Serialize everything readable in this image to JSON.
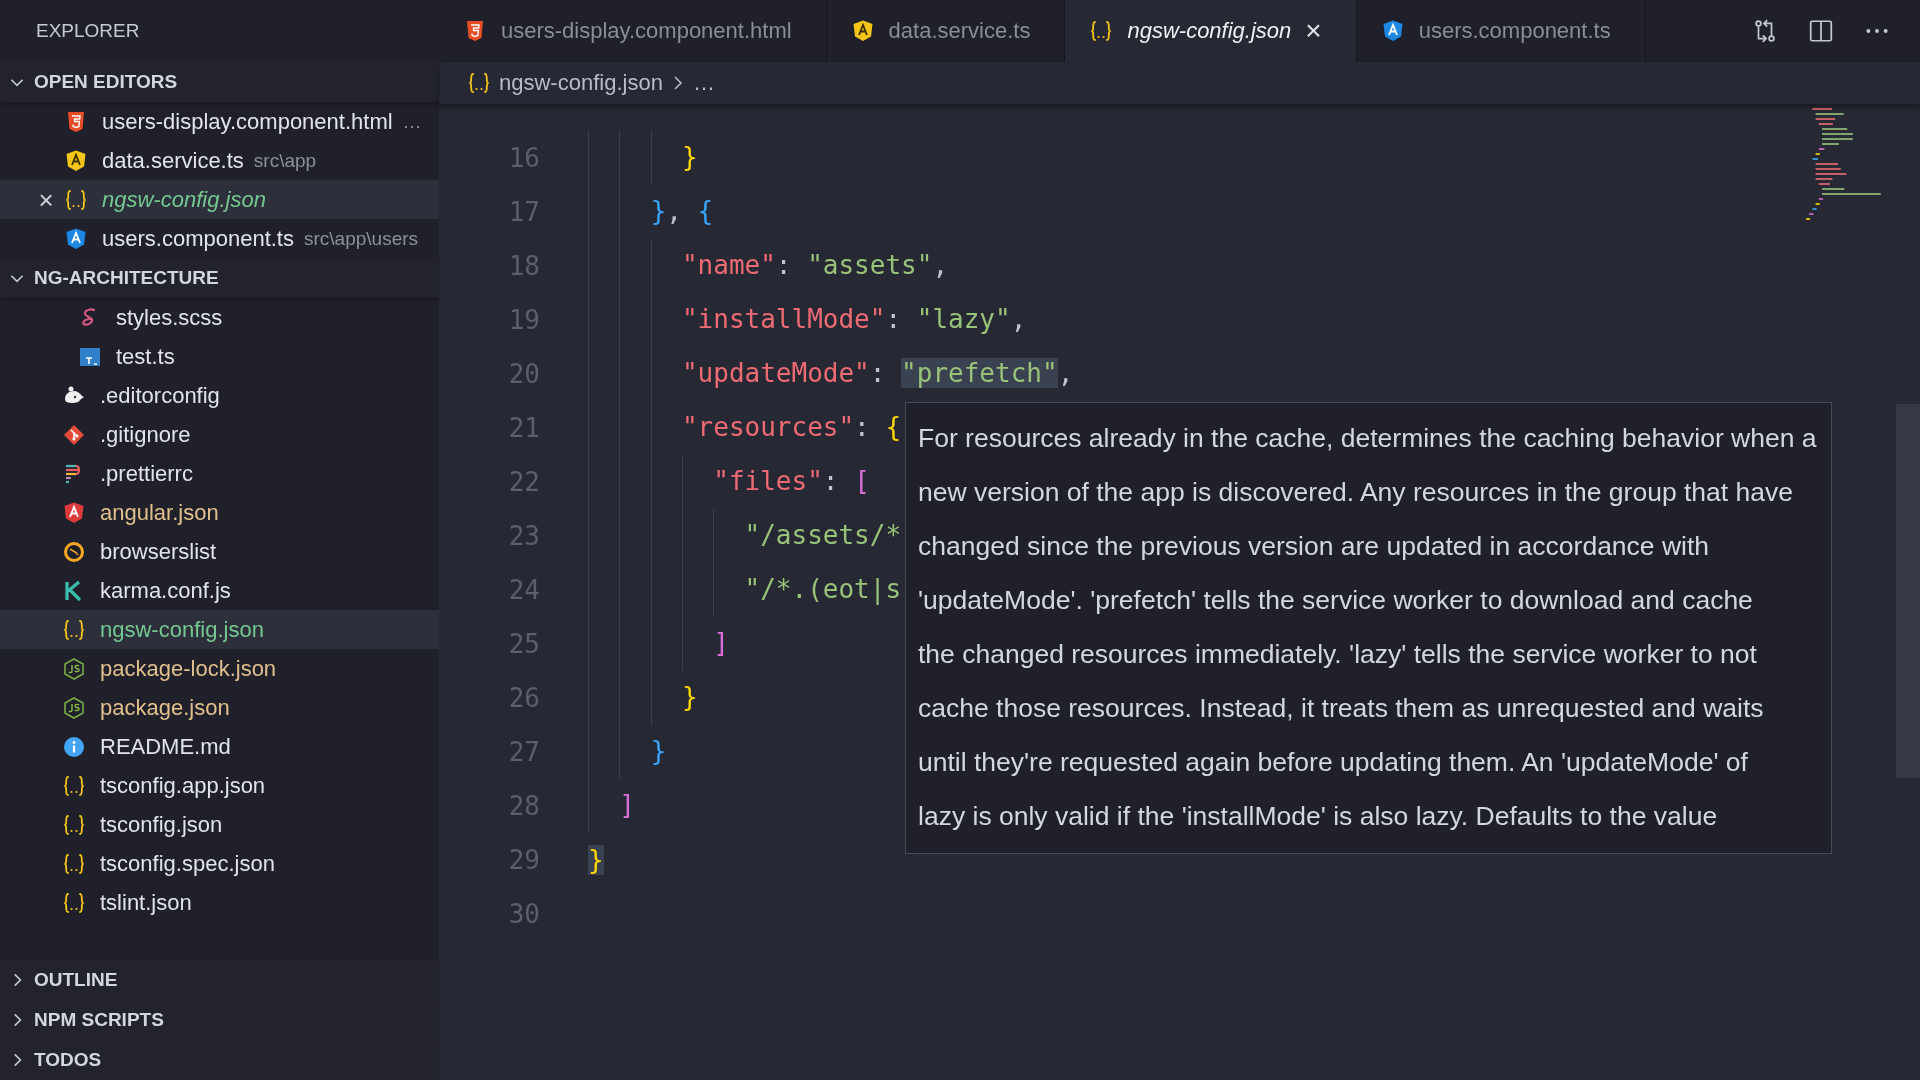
{
  "sidebar": {
    "title": "EXPLORER",
    "open_editors": {
      "title": "OPEN EDITORS",
      "expanded": true,
      "items": [
        {
          "label": "users-display.component.html",
          "description": "…",
          "kind": "html",
          "selected": false
        },
        {
          "label": "data.service.ts",
          "description": "src\\app",
          "kind": "angular-ts",
          "selected": false
        },
        {
          "label": "ngsw-config.json",
          "kind": "json",
          "selected": true,
          "preview": true,
          "color": "#73c991",
          "close": "×"
        },
        {
          "label": "users.component.ts",
          "description": "src\\app\\users",
          "kind": "angular-component",
          "selected": false
        }
      ]
    },
    "project": {
      "title": "NG-ARCHITECTURE",
      "expanded": true,
      "items": [
        {
          "children": [
            {
              "label": "styles.scss",
              "kind": "scss",
              "selected": false
            },
            {
              "label": "test.ts",
              "kind": "ts",
              "selected": false
            }
          ]
        },
        {
          "label": ".editorconfig",
          "kind": "editorconfig",
          "selected": false
        },
        {
          "label": ".gitignore",
          "kind": "git",
          "selected": false
        },
        {
          "label": ".prettierrc",
          "kind": "prettier",
          "selected": false
        },
        {
          "label": "angular.json",
          "kind": "angular-config",
          "selected": false,
          "color": "#e2c08d"
        },
        {
          "label": "browserslist",
          "kind": "browserslist",
          "selected": false
        },
        {
          "label": "karma.conf.js",
          "kind": "karma",
          "selected": false
        },
        {
          "label": "ngsw-config.json",
          "kind": "json",
          "selected": true,
          "color": "#73c991"
        },
        {
          "label": "package-lock.json",
          "kind": "node",
          "selected": false,
          "color": "#e2c08d"
        },
        {
          "label": "package.json",
          "kind": "node",
          "selected": false,
          "color": "#e2c08d"
        },
        {
          "label": "README.md",
          "kind": "info",
          "selected": false
        },
        {
          "label": "tsconfig.app.json",
          "kind": "json",
          "selected": false
        },
        {
          "label": "tsconfig.json",
          "kind": "json",
          "selected": false
        },
        {
          "label": "tsconfig.spec.json",
          "kind": "json",
          "selected": false
        },
        {
          "label": "tslint.json",
          "kind": "json",
          "selected": false
        }
      ]
    },
    "collapsed_sections": [
      {
        "title": "OUTLINE",
        "expanded": false
      },
      {
        "title": "NPM SCRIPTS",
        "expanded": false
      },
      {
        "title": "TODOS",
        "expanded": false
      }
    ]
  },
  "tabs": [
    {
      "label": "users-display.component.html",
      "kind": "html",
      "selected": false
    },
    {
      "label": "data.service.ts",
      "kind": "angular-ts",
      "selected": false
    },
    {
      "label": "ngsw-config.json",
      "kind": "json",
      "selected": true,
      "preview": true,
      "close": "×"
    },
    {
      "label": "users.component.ts",
      "kind": "angular-component",
      "selected": false
    }
  ],
  "breadcrumb": {
    "file": "ngsw-config.json",
    "more": "…"
  },
  "code_lines": [
    {
      "number": "16",
      "tokens": [
        {
          "kind": "bracket-1",
          "text": "      }"
        }
      ]
    },
    {
      "number": "17",
      "tokens": [
        {
          "kind": "bracket-2",
          "text": "    }"
        },
        {
          "kind": "punct",
          "text": ", "
        },
        {
          "kind": "bracket-2",
          "text": "{"
        }
      ]
    },
    {
      "number": "18",
      "tokens": [
        {
          "kind": "key",
          "text": "      \"name\""
        },
        {
          "kind": "punct",
          "text": ": "
        },
        {
          "kind": "string",
          "text": "\"assets\""
        },
        {
          "kind": "punct",
          "text": ","
        }
      ]
    },
    {
      "number": "19",
      "tokens": [
        {
          "kind": "key",
          "text": "      \"installMode\""
        },
        {
          "kind": "punct",
          "text": ": "
        },
        {
          "kind": "string",
          "text": "\"lazy\""
        },
        {
          "kind": "punct",
          "text": ","
        }
      ]
    },
    {
      "number": "20",
      "tokens": [
        {
          "kind": "key",
          "text": "      \"updateMode\""
        },
        {
          "kind": "punct",
          "text": ": "
        },
        {
          "kind": "string",
          "text": "\"prefetch\"",
          "highlighted": true
        },
        {
          "kind": "punct",
          "text": ","
        }
      ]
    },
    {
      "number": "21",
      "tokens": [
        {
          "kind": "key",
          "text": "      \"resources\""
        },
        {
          "kind": "punct",
          "text": ": "
        },
        {
          "kind": "bracket-1",
          "text": "{"
        }
      ]
    },
    {
      "number": "22",
      "tokens": [
        {
          "kind": "key",
          "text": "        \"files\""
        },
        {
          "kind": "punct",
          "text": ": "
        },
        {
          "kind": "bracket-3",
          "text": "["
        }
      ]
    },
    {
      "number": "23",
      "tokens": [
        {
          "kind": "string",
          "text": "          \"/assets/*"
        }
      ]
    },
    {
      "number": "24",
      "tokens": [
        {
          "kind": "string",
          "text": "          \"/*.(eot|s"
        }
      ]
    },
    {
      "number": "25",
      "tokens": [
        {
          "kind": "bracket-3",
          "text": "        ]"
        }
      ]
    },
    {
      "number": "26",
      "tokens": [
        {
          "kind": "bracket-1",
          "text": "      }"
        }
      ]
    },
    {
      "number": "27",
      "tokens": [
        {
          "kind": "bracket-2",
          "text": "    }"
        }
      ]
    },
    {
      "number": "28",
      "tokens": [
        {
          "kind": "bracket-3",
          "text": "  ]"
        }
      ]
    },
    {
      "number": "29",
      "tokens": [
        {
          "kind": "bracket-1",
          "text": "}",
          "highlighted": true
        }
      ]
    },
    {
      "number": "30"
    }
  ],
  "hover_tooltip": {
    "lines": [
      "For resources already in the cache, determines the caching behavior when a",
      "new version of the app is discovered. Any resources in the group that have",
      "changed since the previous version are updated in accordance with",
      "'updateMode'. 'prefetch' tells the service worker to download and cache",
      "the changed resources immediately. 'lazy' tells the service worker to not",
      "cache those resources. Instead, it treats them as unrequested and waits",
      "until they're requested again before updating them. An 'updateMode' of",
      "lazy is only valid if the 'installMode' is also lazy. Defaults to the value"
    ]
  }
}
